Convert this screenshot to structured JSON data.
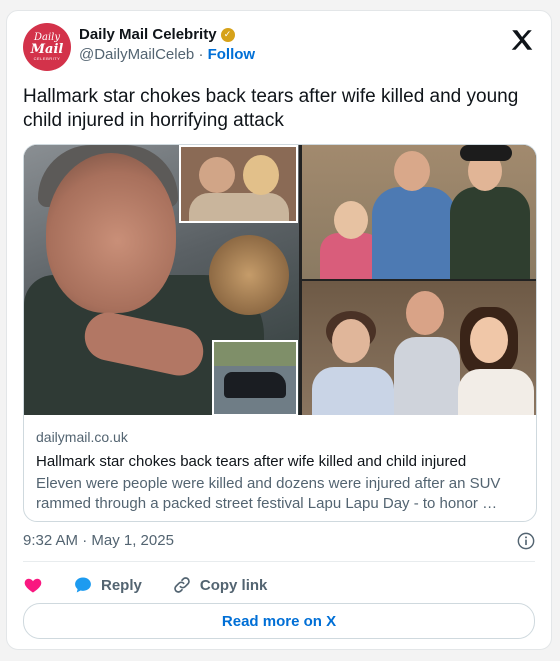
{
  "account": {
    "avatar_text": {
      "line1": "Daily",
      "line2": "Mail",
      "line3": "CELEBRITY"
    },
    "display_name": "Daily Mail Celebrity",
    "handle": "@DailyMailCeleb",
    "separator": "·",
    "follow_label": "Follow",
    "verified_color": "#d6a21a"
  },
  "tweet": {
    "text": "Hallmark star chokes back tears after wife killed and young child injured in horrifying attack"
  },
  "link_card": {
    "domain": "dailymail.co.uk",
    "title": "Hallmark star chokes back tears after wife killed and child injured",
    "description": "Eleven were people were killed and dozens were injured after an SUV rammed through a packed street festival  Lapu Lapu Day - to honor …"
  },
  "meta": {
    "timestamp": "9:32 AM · May 1, 2025"
  },
  "actions": {
    "like_icon": "heart-icon",
    "reply_label": "Reply",
    "copy_link_label": "Copy link",
    "read_more_label": "Read more on X"
  },
  "colors": {
    "accent": "#006fd6",
    "like": "#f91880",
    "brand": "#d3324a"
  }
}
